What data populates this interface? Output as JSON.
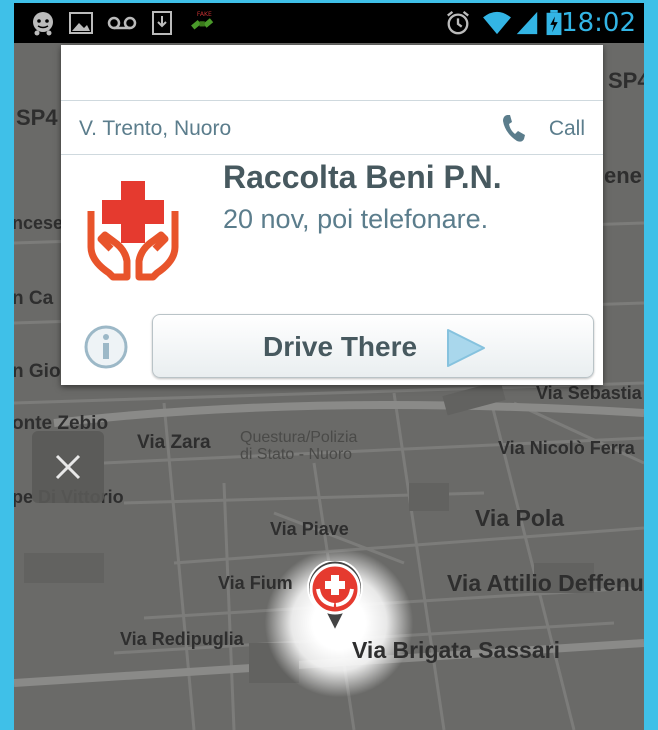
{
  "status_bar": {
    "time": "18:02",
    "icons": [
      "waze-icon",
      "image-icon",
      "voicemail-icon",
      "download-icon",
      "satellite-icon",
      "alarm-icon",
      "wifi-icon",
      "signal-icon",
      "battery-charging-icon"
    ]
  },
  "card": {
    "address": "V. Trento, Nuoro",
    "call_label": "Call",
    "title": "Raccolta Beni P.N.",
    "subtitle": "20 nov, poi telefonare.",
    "drive_label": "Drive There",
    "poi_icon": "red-cross-hands-icon",
    "accent_color": "#e53a2f"
  },
  "map": {
    "streets": [
      {
        "name": "Via Zara"
      },
      {
        "name": "Via Nicolò Ferra"
      },
      {
        "name": "Via Pola"
      },
      {
        "name": "Via Piave"
      },
      {
        "name": "Via Fium"
      },
      {
        "name": "Via Attilio Deffenu"
      },
      {
        "name": "Via Redipuglia"
      },
      {
        "name": "Via Brigata Sassari"
      },
      {
        "name": "Via Sebastia"
      },
      {
        "name": "onte Zebio"
      },
      {
        "name": "pe Di Vittorio"
      },
      {
        "name": "n Gio"
      },
      {
        "name": "n Ca"
      },
      {
        "name": "ncese"
      },
      {
        "name": "SP4"
      },
      {
        "name": "SP4"
      },
      {
        "name": "ene"
      }
    ],
    "poi_text": [
      "Questura/Polizia",
      "di Stato - Nuoro"
    ]
  }
}
